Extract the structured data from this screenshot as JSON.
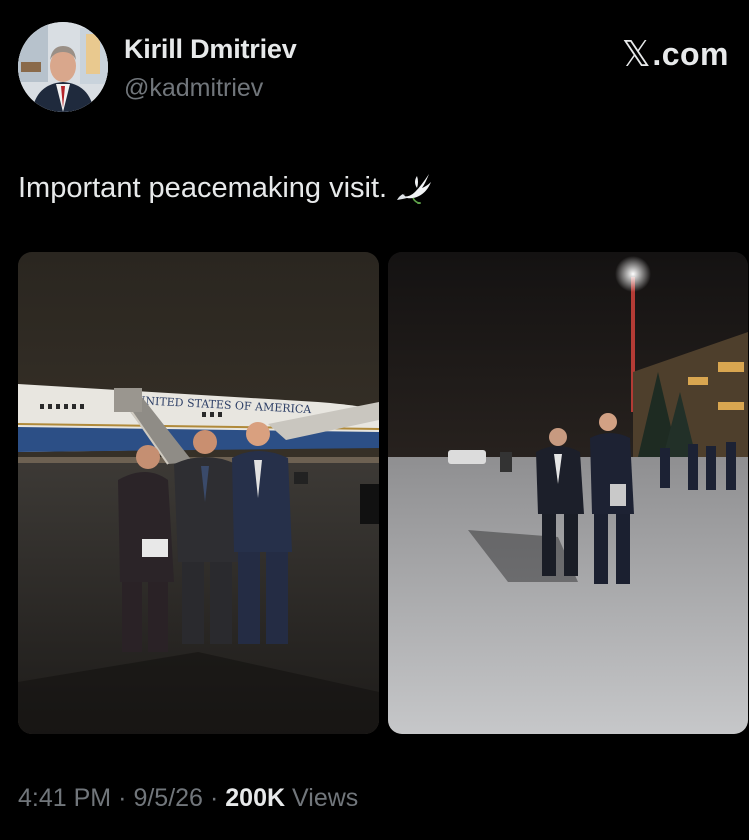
{
  "author": {
    "name": "Kirill Dmitriev",
    "handle": "@kadmitriev"
  },
  "brand": {
    "label": ".com",
    "icon": "x-logo-icon"
  },
  "tweet": {
    "text": "Important peacemaking visit.",
    "emoji_icon": "dove-icon"
  },
  "photos": {
    "left": {
      "aircraft_text": "UNITED STATES OF AMERICA",
      "icon": "photo-airplane-group"
    },
    "right": {
      "icon": "photo-tarmac-night"
    }
  },
  "meta": {
    "time": "4:41 PM",
    "separator": "·",
    "date": "9/5/26",
    "views_count": "200K",
    "views_label": "Views"
  },
  "colors": {
    "background": "#000000",
    "primary_text": "#e7e9ea",
    "secondary_text": "#71767b"
  }
}
